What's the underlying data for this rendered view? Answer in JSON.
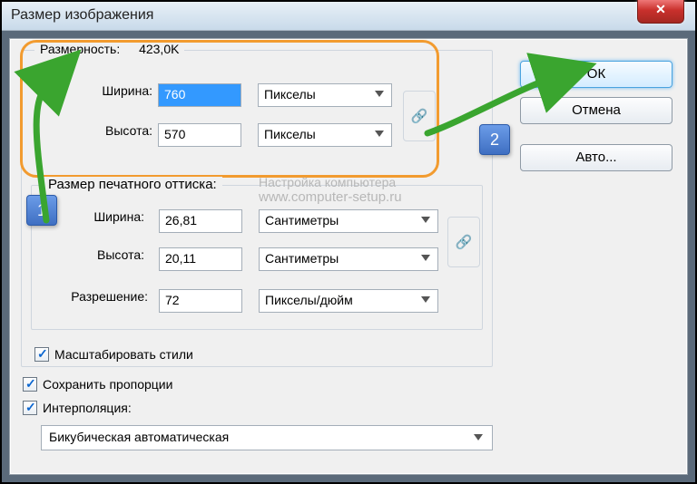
{
  "window": {
    "title": "Размер изображения"
  },
  "dimensions": {
    "legend": "Размерность:",
    "size_text": "423,0K",
    "width_label": "Ширина:",
    "width_value": "760",
    "width_unit": "Пикселы",
    "height_label": "Высота:",
    "height_value": "570",
    "height_unit": "Пикселы"
  },
  "print": {
    "legend": "Размер печатного оттиска:",
    "width_label": "Ширина:",
    "width_value": "26,81",
    "width_unit": "Сантиметры",
    "height_label": "Высота:",
    "height_value": "20,11",
    "height_unit": "Сантиметры",
    "res_label": "Разрешение:",
    "res_value": "72",
    "res_unit": "Пикселы/дюйм"
  },
  "checks": {
    "scale_styles": "Масштабировать стили",
    "constrain": "Сохранить пропорции",
    "interpolation": "Интерполяция:"
  },
  "interpolation_method": "Бикубическая автоматическая",
  "buttons": {
    "ok": "ОК",
    "cancel": "Отмена",
    "auto": "Авто..."
  },
  "watermark": {
    "line1": "Настройка компьютера",
    "line2": "www.computer-setup.ru"
  },
  "callouts": {
    "one": "1",
    "two": "2"
  },
  "icons": {
    "close": "✕",
    "check": "✓",
    "link": "🔗"
  }
}
